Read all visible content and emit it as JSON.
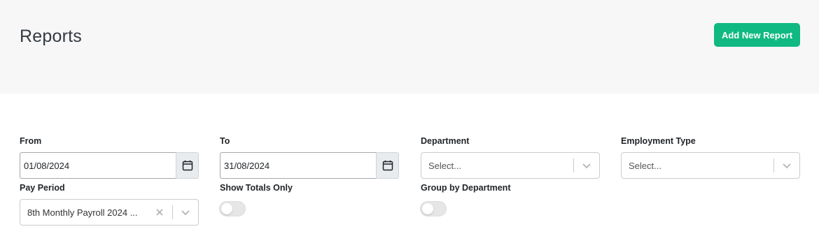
{
  "header": {
    "title": "Reports",
    "add_button_label": "Add New Report"
  },
  "filters": {
    "from": {
      "label": "From",
      "value": "01/08/2024"
    },
    "to": {
      "label": "To",
      "value": "31/08/2024"
    },
    "department": {
      "label": "Department",
      "placeholder": "Select..."
    },
    "employment_type": {
      "label": "Employment Type",
      "placeholder": "Select..."
    },
    "pay_period": {
      "label": "Pay Period",
      "value": "8th Monthly Payroll 2024 ..."
    },
    "show_totals_only": {
      "label": "Show Totals Only",
      "on": false
    },
    "group_by_department": {
      "label": "Group by Department",
      "on": false
    }
  },
  "colors": {
    "accent": "#10b981",
    "header_bg": "#f7f7f8"
  },
  "icons": {
    "calendar": "calendar-icon",
    "chevron": "chevron-down-icon",
    "clear": "close-icon"
  }
}
